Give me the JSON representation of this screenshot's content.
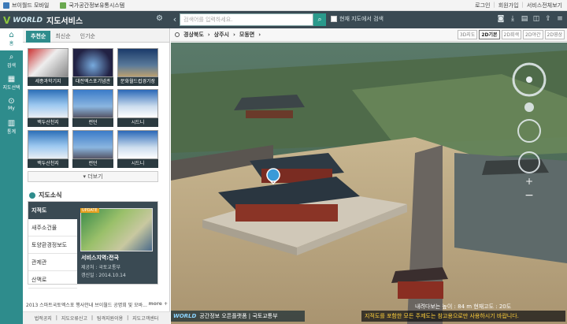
{
  "topbar": {
    "left": [
      "브이월드 모바일",
      "국가공간정보유통시스템"
    ],
    "right": [
      "로그인",
      "회원가입",
      "서비스전체보기"
    ]
  },
  "header": {
    "logo_mark": "V",
    "logo_word": "WORLD",
    "service_title": "지도서비스",
    "search_placeholder": "검색어를 입력하세요.",
    "nearby_label": "현재 지도에서 검색"
  },
  "leftnav": [
    {
      "icon": "home-icon",
      "label": "홈"
    },
    {
      "icon": "search-icon",
      "label": "검색"
    },
    {
      "icon": "map-icon",
      "label": "지도선택"
    },
    {
      "icon": "location-pin-icon",
      "label": "My"
    },
    {
      "icon": "stats-icon",
      "label": "통계"
    }
  ],
  "panel": {
    "tabs": [
      "추천순",
      "최신순",
      "인기순"
    ],
    "thumbs": [
      "세종과학기지",
      "대전엑스포기념관",
      "문화월드컵경기장",
      "백두산천지",
      "런던",
      "시드니",
      "백두산천지",
      "런던",
      "시드니"
    ],
    "more_label": "▾ 더보기",
    "news_title": "지도소식",
    "news_items": [
      "지적도",
      "새주소건물",
      "토양환경정보도",
      "관제관",
      "산맥로"
    ],
    "news_detail": {
      "badge": "UPDATE",
      "title": "서비스지역:전국",
      "provider": "제공처 : 국토교통부",
      "updated": "갱신일 : 2014.10.14"
    },
    "ticker": "2013 스마트국토엑스포 행사안내 브이월드 공명회 및 모바...",
    "ticker_more": "more +",
    "footer": [
      "법적공지",
      "지도오류신고",
      "팀격지원이용",
      "지도고객센터"
    ]
  },
  "map": {
    "breadcrumb": [
      "경상북도",
      "상주시",
      "모동면"
    ],
    "modes": [
      "3D지도",
      "2D기본",
      "2D회색",
      "2D야간",
      "2D영상"
    ],
    "active_mode": "2D기본",
    "scale_text": "내려다보는 높이 : 84 m   현재고도 : 20도",
    "warning": "지적도를 포함한 모든 주제도는 참고용으로만 사용하시기 바랍니다.",
    "brand_word": "WORLD",
    "brand_text": "공간정보 오픈플랫폼  |  국토교통부"
  }
}
